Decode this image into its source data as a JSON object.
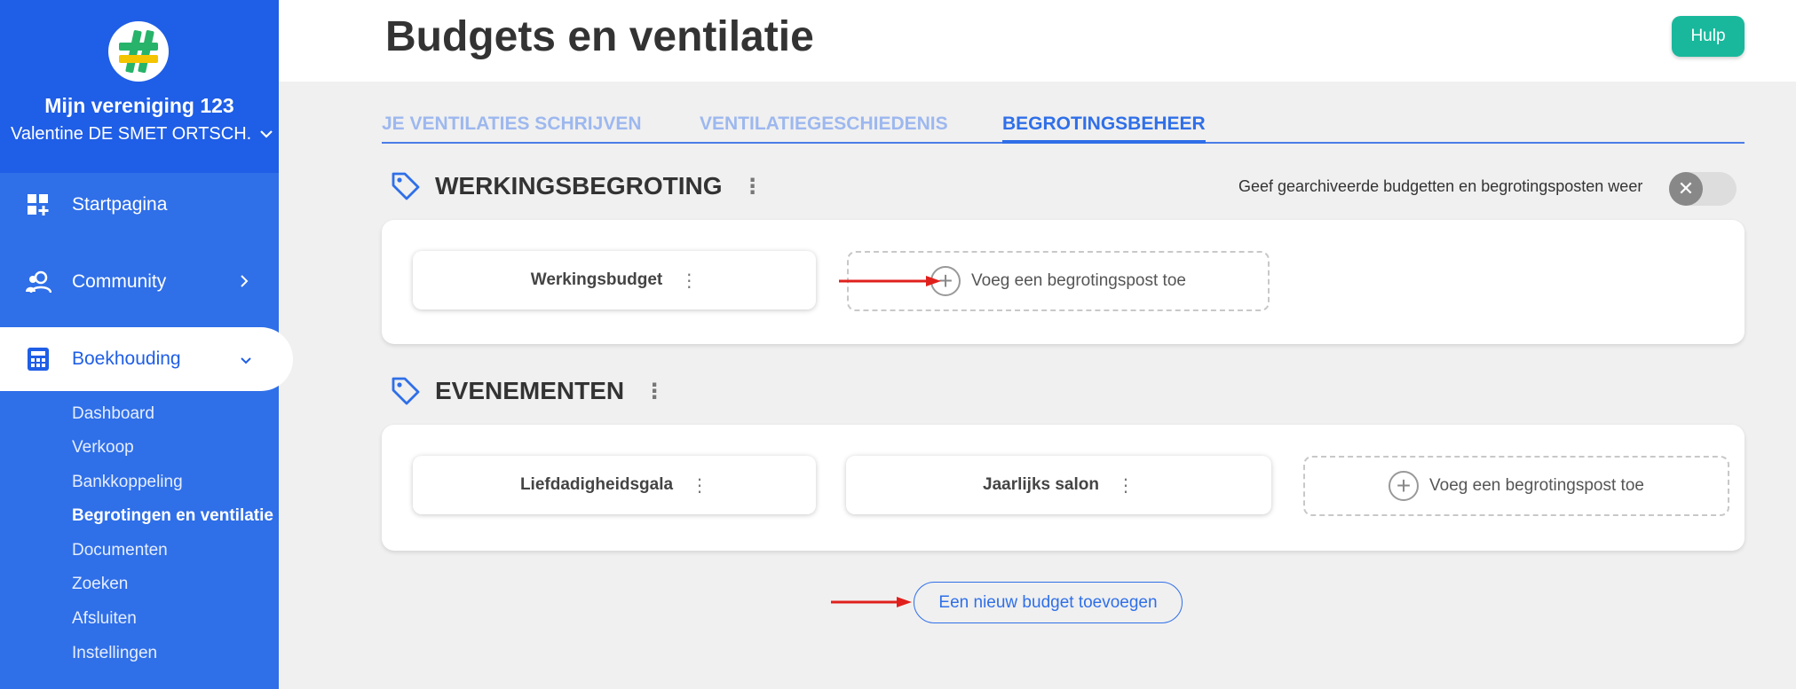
{
  "sidebar": {
    "org_name": "Mijn vereniging 123",
    "user_name": "Valentine DE SMET ORTSCH...",
    "nav": [
      {
        "label": "Startpagina",
        "icon": "dashboard-icon"
      },
      {
        "label": "Community",
        "icon": "people-icon"
      },
      {
        "label": "Boekhouding",
        "icon": "calculator-icon"
      }
    ],
    "sub_items": [
      "Dashboard",
      "Verkoop",
      "Bankkoppeling",
      "Begrotingen en ventilatie",
      "Documenten",
      "Zoeken",
      "Afsluiten",
      "Instellingen"
    ]
  },
  "header": {
    "title": "Budgets en ventilatie",
    "help_label": "Hulp"
  },
  "tabs": [
    "JE VENTILATIES SCHRIJVEN",
    "VENTILATIEGESCHIEDENIS",
    "BEGROTINGSBEHEER"
  ],
  "archive_toggle_label": "Geef gearchiveerde budgetten en begrotingsposten weer",
  "sections": [
    {
      "title": "WERKINGSBEGROTING",
      "cards": [
        "Werkingsbudget"
      ],
      "add_label": "Voeg een begrotingspost toe"
    },
    {
      "title": "EVENEMENTEN",
      "cards": [
        "Liefdadigheidsgala",
        "Jaarlijks salon"
      ],
      "add_label": "Voeg een begrotingspost toe"
    }
  ],
  "new_budget_label": "Een nieuw budget toevoegen",
  "colors": {
    "primary": "#2f6fe8",
    "sidebar_head": "#1f5ee6",
    "help": "#19b89c",
    "annotation_arrow": "#e0201c"
  }
}
